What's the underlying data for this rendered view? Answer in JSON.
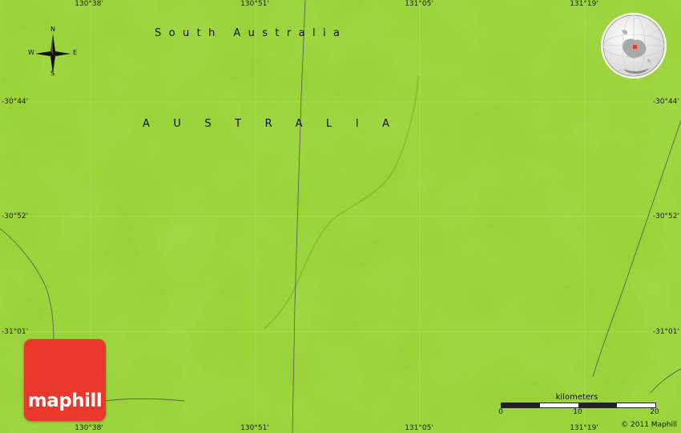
{
  "map": {
    "region_label": "South Australia",
    "country_label": "AUSTRALIA",
    "land_color": "#8fcf2b",
    "grid_color": "#a9dc5a",
    "line_color": "#555555"
  },
  "graticule": {
    "top_longitudes": [
      "130°38'",
      "130°51'",
      "131°05'",
      "131°19'"
    ],
    "bottom_longitudes": [
      "130°38'",
      "130°51'",
      "131°05'",
      "131°19'"
    ],
    "left_latitudes": [
      "-30°44'",
      "-30°52'",
      "-31°01'"
    ],
    "right_latitudes": [
      "-30°44'",
      "-30°52'",
      "-31°01'"
    ]
  },
  "compass": {
    "north": "N",
    "south": "S",
    "east": "E",
    "west": "W",
    "icon": "compass-rose-icon"
  },
  "globe": {
    "icon": "globe-locator-icon",
    "marker_color": "#e8392c"
  },
  "logo": {
    "text": "maphill",
    "color": "#e8392c"
  },
  "scale": {
    "title": "kilometers",
    "ticks": [
      "0",
      "10",
      "20"
    ]
  },
  "copyright": "© 2011 Maphill"
}
